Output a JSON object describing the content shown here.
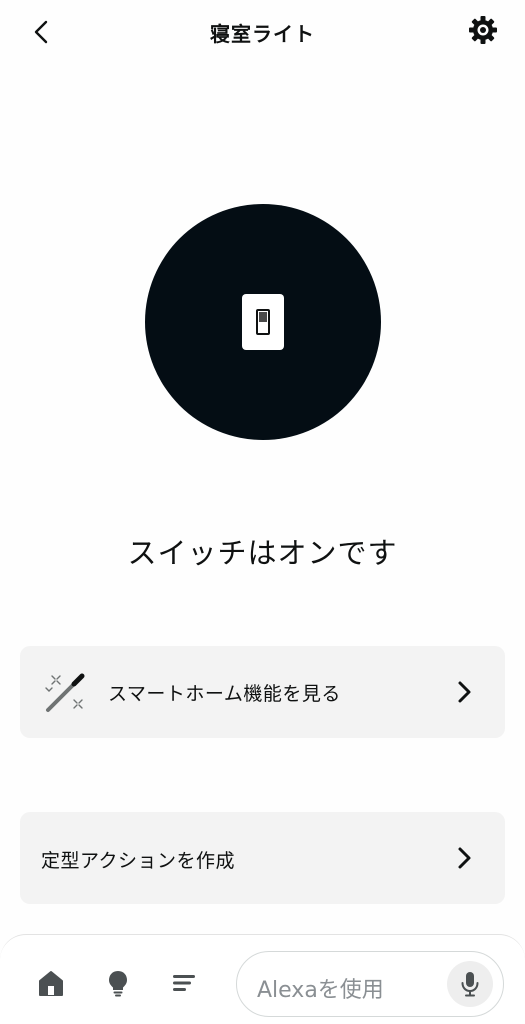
{
  "header": {
    "title": "寝室ライト",
    "back_icon": "chevron-left-icon",
    "settings_icon": "gear-icon"
  },
  "device": {
    "icon": "light-switch-icon",
    "circle_color": "#040d14",
    "status": "スイッチはオンです"
  },
  "cards": [
    {
      "label": "スマートホーム機能を見る",
      "icon": "magic-wand-icon",
      "chevron": "chevron-right-icon"
    },
    {
      "label": "定型アクションを作成",
      "chevron": "chevron-right-icon"
    }
  ],
  "bottom_nav": {
    "items": [
      {
        "icon": "home-icon"
      },
      {
        "icon": "lightbulb-icon"
      },
      {
        "icon": "menu-lines-icon"
      }
    ],
    "alexa_input": {
      "placeholder": "Alexaを使用",
      "mic_icon": "microphone-icon"
    }
  },
  "colors": {
    "card_background": "#f3f3f3",
    "text": "#0f1111",
    "placeholder_text": "#8a8f93"
  }
}
